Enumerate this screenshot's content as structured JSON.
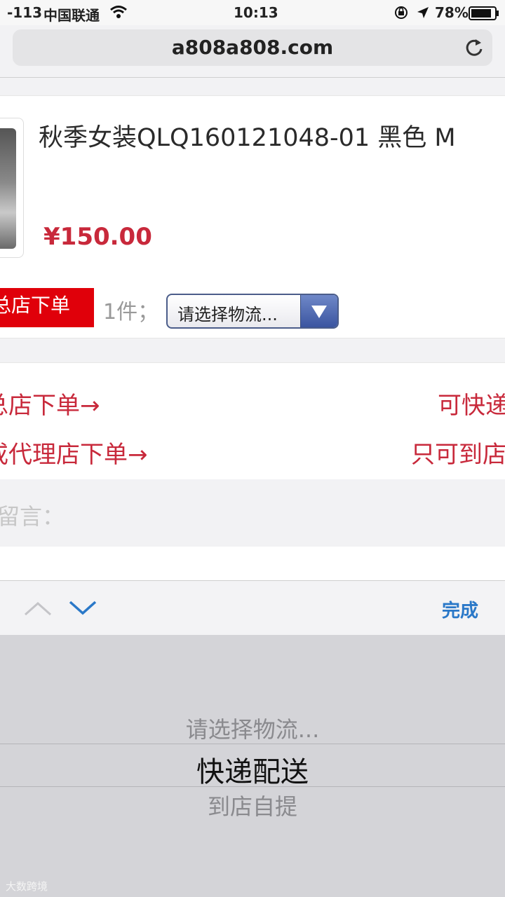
{
  "status_bar": {
    "signal": "-113",
    "carrier": "中国联通",
    "time": "10:13",
    "battery": "78%",
    "icons": [
      "wifi-icon",
      "rotation-lock-icon",
      "location-arrow-icon",
      "battery-icon"
    ]
  },
  "browser": {
    "url": "a808a808.com",
    "reload_icon": "reload-icon"
  },
  "product": {
    "title": "秋季女装QLQ160121048-01 黑色 M",
    "price": "¥150.00",
    "order_button": "总店下单",
    "quantity": "1件；",
    "logistics_select": "请选择物流..."
  },
  "links": [
    {
      "left": "总店下单→",
      "right": "可快递"
    },
    {
      "left": "或代理店下单→",
      "right": "只可到店"
    }
  ],
  "message": {
    "label": "留言："
  },
  "keyboard_toolbar": {
    "prev_icon": "chevron-up-icon",
    "next_icon": "chevron-down-icon",
    "done": "完成"
  },
  "picker": {
    "options": [
      "请选择物流...",
      "快递配送",
      "到店自提"
    ],
    "selected": "快递配送"
  },
  "watermark": "大数跨境",
  "colors": {
    "accent_red": "#c8293b",
    "button_red": "#e0000a",
    "ios_blue": "#2a78c8"
  }
}
